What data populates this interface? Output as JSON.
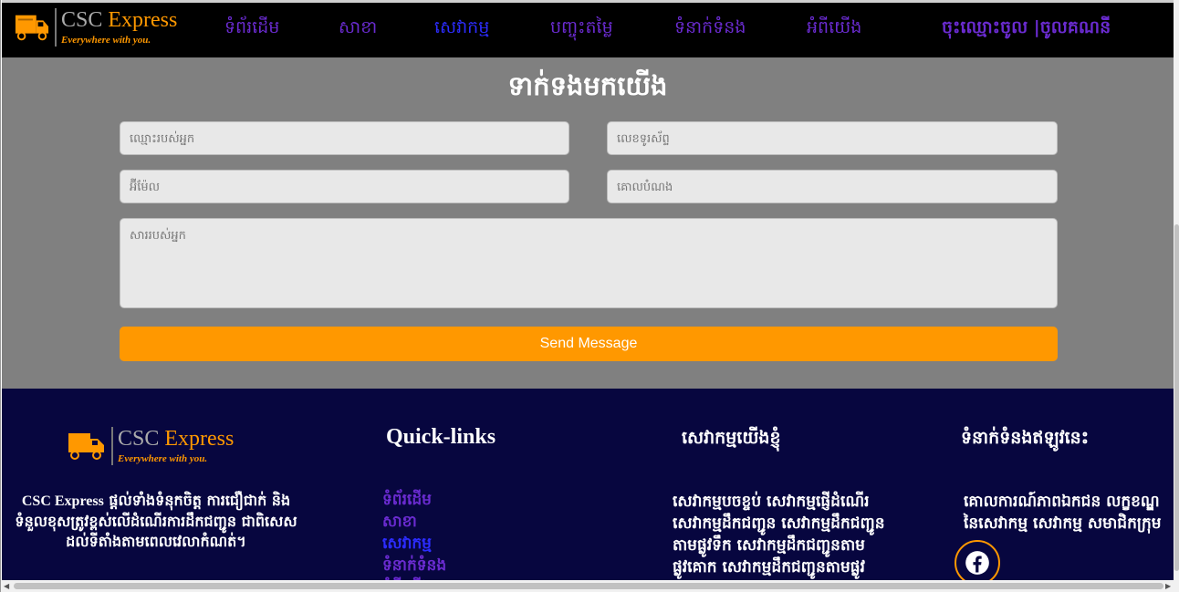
{
  "brand": {
    "name_part1": "CSC",
    "name_part2": " Express",
    "tagline": "Everywhere with you."
  },
  "nav": {
    "items": [
      {
        "label": "ទំព័រដើម",
        "active": false
      },
      {
        "label": "សាខា",
        "active": false
      },
      {
        "label": "សេវាកម្ម",
        "active": true
      },
      {
        "label": "បញ្ចុះតម្លៃ",
        "active": false
      },
      {
        "label": "ទំនាក់ទំនង",
        "active": false
      },
      {
        "label": "អំពីយើង",
        "active": false
      }
    ],
    "auth": "ចុះឈ្មោះចូល |ចូលគណនី"
  },
  "contact": {
    "title": "ទាក់ទងមកយើង",
    "name_placeholder": "ឈ្មោះរបស់អ្នក",
    "phone_placeholder": "លេខទូរស័ព្ទ",
    "email_placeholder": "អ៊ីម៉ែល",
    "subject_placeholder": "គោលបំណង",
    "message_placeholder": "សាររបស់អ្នក",
    "send_label": "Send Message"
  },
  "footer": {
    "about_brand": "CSC Express",
    "about_text": " ផ្តល់ទាំងទំនុកចិត្ត ការជឿជាក់ និងទំនួលខុសត្រូវខ្ពស់លើដំណើរការដឹកជញ្ជូន ជាពិសេសដល់ទីតាំងតាមពេលវេលាកំណត់។",
    "quicklinks_title": "Quick-links",
    "quicklinks": [
      {
        "label": "ទំព័រដើម",
        "active": false
      },
      {
        "label": "សាខា",
        "active": false
      },
      {
        "label": "សេវាកម្ម",
        "active": true
      },
      {
        "label": "ទំនាក់ទំនង",
        "active": false
      },
      {
        "label": "អំពីយើង",
        "active": false
      }
    ],
    "services_title": "សេវាកម្មយើងខ្ញុំ",
    "services_text": "សេវាកម្មបចខ្ចប់ សេវាកម្មផ្ញើដំណើរ សេវាកម្មដឹកជញ្ជូន សេវាកម្មដឹកជញ្ជូនតាមផ្លូវទឹក សេវាកម្មដឹកជញ្ជូនតាមផ្លូវគោក សេវាកម្មដឹកជញ្ជូនតាមផ្លូវអាកាស",
    "contact_title": "ទំនាក់ទំនងឥឡូវនេះ",
    "contact_text": "គោលការណ៍ភាពឯកជន លក្ខខណ្ឌនៃសេវាកម្ម សេវាកម្ម សមាជិកក្រុម",
    "social_icon": "facebook-icon"
  },
  "colors": {
    "accent": "#ff9800",
    "nav_link": "#6a2bd0",
    "nav_active": "#2c2cff",
    "footer_bg": "#07063f",
    "contact_bg": "#808080"
  }
}
